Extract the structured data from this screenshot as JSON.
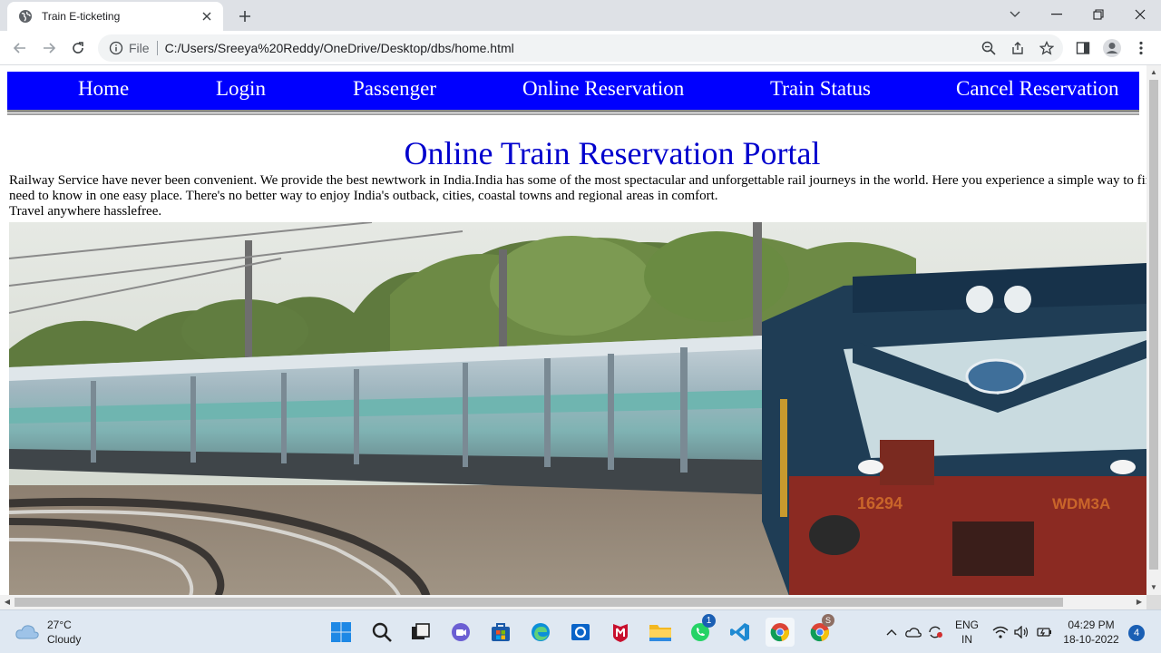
{
  "browser": {
    "tab_title": "Train E-ticketing",
    "address_scheme": "File",
    "address_url": "C:/Users/Sreeya%20Reddy/OneDrive/Desktop/dbs/home.html"
  },
  "site": {
    "nav": [
      "Home",
      "Login",
      "Passenger",
      "Online Reservation",
      "Train Status",
      "Cancel Reservation"
    ],
    "title": "Online Train Reservation Portal",
    "intro_line1": "Railway Service have never been convenient. We provide the best newtwork in India.India has some of the most spectacular and unforgettable rail journeys in the world. Here you experience a simple way to find out everything you",
    "intro_line2": "need to know in one easy place. There's no better way to enjoy India's outback, cities, coastal towns and regional areas in comfort.",
    "intro_line3": "Travel anywhere hasslefree.",
    "loco_number": "16294",
    "loco_class": "WDM3A"
  },
  "taskbar": {
    "weather_temp": "27°C",
    "weather_desc": "Cloudy",
    "lang_line1": "ENG",
    "lang_line2": "IN",
    "time": "04:29 PM",
    "date": "18-10-2022",
    "notification_count": "4",
    "whatsapp_badge": "1",
    "chrome_profile_badge": "S"
  },
  "colors": {
    "nav_bg": "#0000ff",
    "title_color": "#0000cd",
    "taskbar_bg": "#dfe8f2"
  }
}
